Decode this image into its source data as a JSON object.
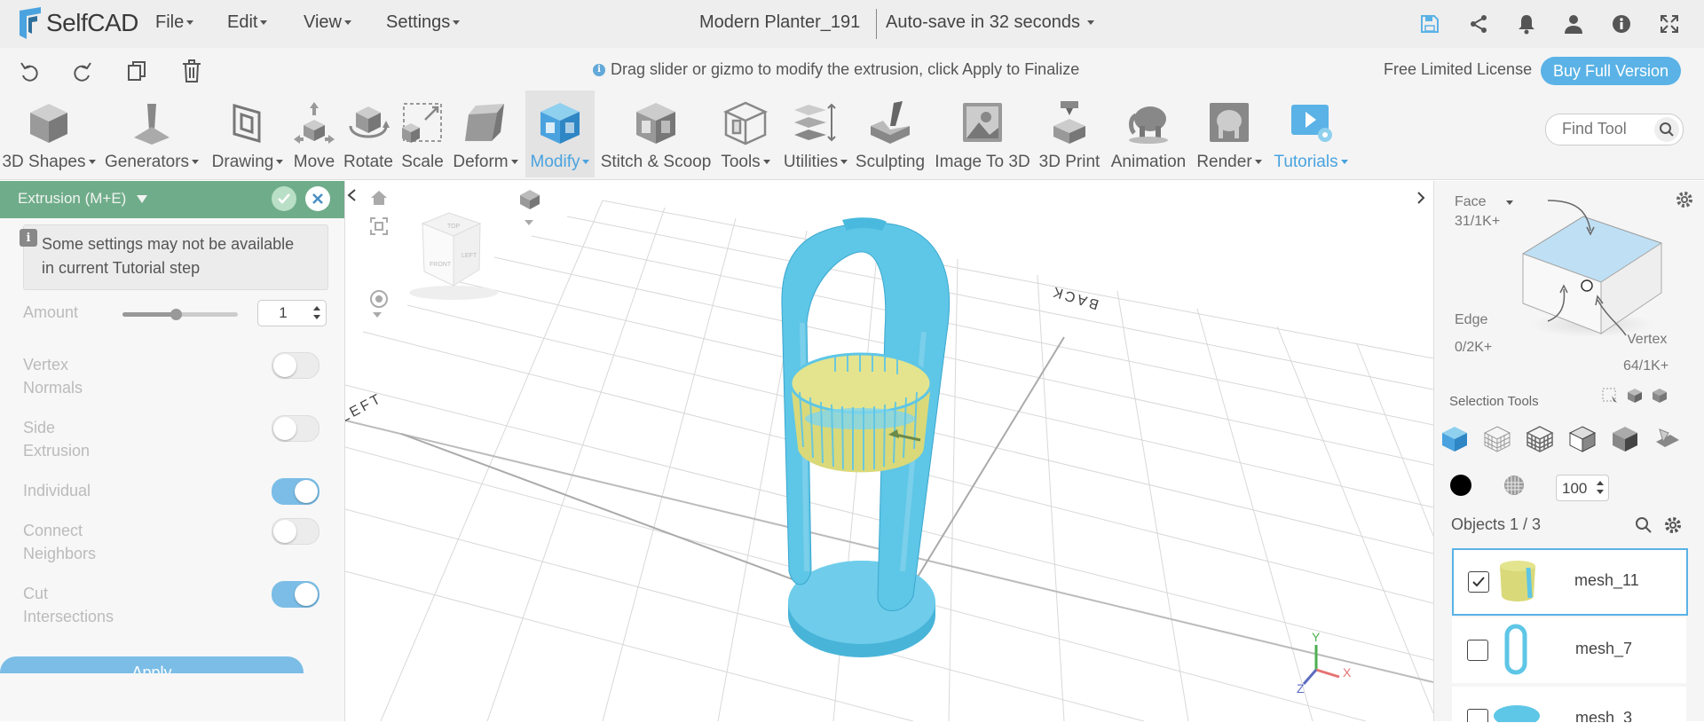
{
  "app": {
    "name": "SelfCAD"
  },
  "menu": [
    "File",
    "Edit",
    "View",
    "Settings"
  ],
  "document": {
    "title": "Modern Planter_191",
    "autosave": "Auto-save in 32 seconds"
  },
  "hint": "Drag slider or gizmo to modify the extrusion, click Apply to Finalize",
  "license": {
    "text": "Free Limited License",
    "buy": "Buy Full Version"
  },
  "tools": [
    {
      "label": "3D Shapes",
      "dropdown": true
    },
    {
      "label": "Generators",
      "dropdown": true
    },
    {
      "label": "Drawing",
      "dropdown": true
    },
    {
      "label": "Move",
      "dropdown": false
    },
    {
      "label": "Rotate",
      "dropdown": false
    },
    {
      "label": "Scale",
      "dropdown": false
    },
    {
      "label": "Deform",
      "dropdown": true
    },
    {
      "label": "Modify",
      "dropdown": true,
      "active": true
    },
    {
      "label": "Stitch & Scoop",
      "dropdown": false
    },
    {
      "label": "Tools",
      "dropdown": true
    },
    {
      "label": "Utilities",
      "dropdown": true
    },
    {
      "label": "Sculpting",
      "dropdown": false
    },
    {
      "label": "Image To 3D",
      "dropdown": false
    },
    {
      "label": "3D Print",
      "dropdown": false
    },
    {
      "label": "Animation",
      "dropdown": false
    },
    {
      "label": "Render",
      "dropdown": true
    },
    {
      "label": "Tutorials",
      "dropdown": true
    }
  ],
  "find_tool": {
    "placeholder": "Find Tool"
  },
  "panel": {
    "title": "Extrusion (M+E)",
    "note": "Some settings may not be available in current Tutorial step",
    "amount_label": "Amount",
    "amount_value": "1",
    "amount_slider_fraction": 0.46,
    "options": [
      {
        "label": "Vertex Normals",
        "on": false
      },
      {
        "label": "Side Extrusion",
        "on": false
      },
      {
        "label": "Individual",
        "on": true
      },
      {
        "label": "Connect Neighbors",
        "on": false
      },
      {
        "label": "Cut Intersections",
        "on": true
      }
    ],
    "apply": "Apply"
  },
  "viewport": {
    "labels": {
      "back": "BACK",
      "left": "LEFT",
      "cube_top": "TOP",
      "cube_front": "FRONT",
      "cube_side": "LEFT"
    },
    "axes": {
      "x": "X",
      "y": "Y",
      "z": "Z"
    }
  },
  "selection": {
    "face_label": "Face",
    "face_count": "31/1K+",
    "edge_label": "Edge",
    "edge_count": "0/2K+",
    "vertex_label": "Vertex",
    "vertex_count": "64/1K+",
    "tools_label": "Selection Tools",
    "opacity_value": "100"
  },
  "objects": {
    "header": "Objects 1 / 3",
    "items": [
      {
        "name": "mesh_11",
        "checked": true
      },
      {
        "name": "mesh_7",
        "checked": false
      },
      {
        "name": "mesh_3",
        "checked": false
      }
    ]
  },
  "colors": {
    "accent": "#5ab2e6",
    "panel_header": "#6fac8a",
    "mesh_blue": "#5ec6e6",
    "mesh_yellow": "#d9d97a"
  }
}
